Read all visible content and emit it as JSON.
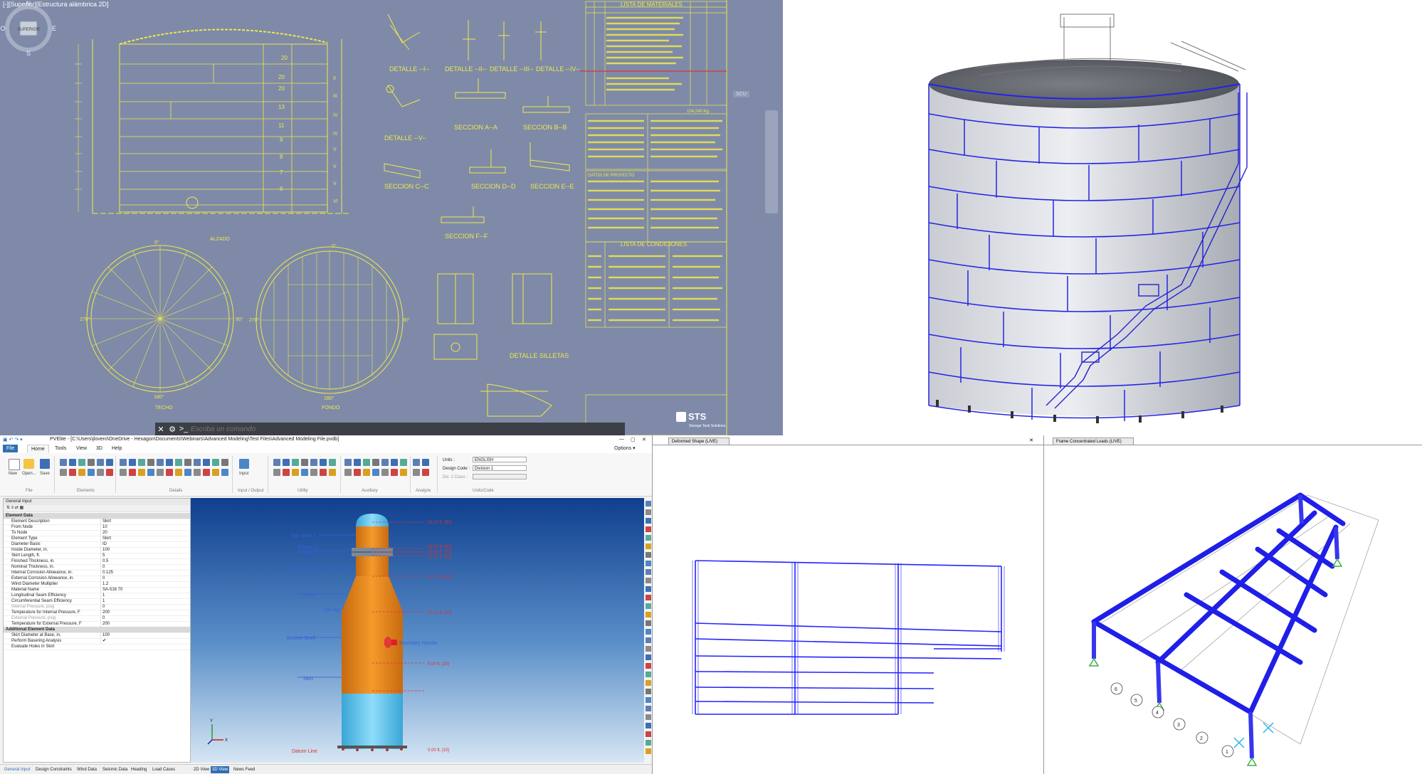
{
  "cad": {
    "viewport_label": "[-][Superior][Estructura alámbrica 2D]",
    "details": [
      "DETALLE --I--",
      "DETALLE --II--",
      "DETALLE --III--",
      "DETALLE --IV--",
      "DETALLE --V--"
    ],
    "sections": [
      "SECCION A--A",
      "SECCION B--B",
      "SECCION C--C",
      "SECCION D--D",
      "SECCION E--E",
      "SECCION F--F"
    ],
    "table_materials": "LISTA DE MATERIALES",
    "table_conditions": "LISTA DE CONDICIONES",
    "table_project": "DATOS DE PROYECTO",
    "total_weight": "104.240 Kg.",
    "label_alzado": "ALZADO",
    "label_techo": "TECHO",
    "label_fondo": "FONDO",
    "label_silletas": "DETALLE SILLETAS",
    "ring_numbers": [
      "20",
      "20",
      "20",
      "13",
      "11",
      "9",
      "8",
      "7",
      "6"
    ],
    "ring_romans": [
      "II",
      "III",
      "IV",
      "IV",
      "V",
      "V",
      "V",
      "VI"
    ],
    "angles": [
      "0°",
      "90°",
      "270°",
      "180°"
    ],
    "command_placeholder": "Escriba un comando",
    "compass": {
      "n": "N",
      "e": "E",
      "s": "S",
      "w": "O",
      "cube": "SUPERIOR",
      "ucs": "SCU"
    },
    "brand": "STS",
    "brand_sub": "Storage Tank Solutions"
  },
  "pvelite": {
    "window_title": "PVElite - [C:\\Users\\jlovero\\OneDrive - Hexagon\\Documents\\Webinars\\Advanced Modeling\\Test Files\\Advanced Modeling File.pvdb]",
    "options_label": "Options ▾",
    "menu": [
      "File",
      "Home",
      "Tools",
      "View",
      "3D",
      "Help"
    ],
    "ribbon": {
      "new": "New",
      "open": "Open...",
      "save": "Save",
      "input": "Input",
      "groups": [
        "File",
        "Elements",
        "Details",
        "Input / Output",
        "Utility",
        "Auxiliary",
        "Analyze",
        "Units/Code"
      ],
      "units_label": "Units :",
      "units_value": "ENGLISH",
      "code_label": "Design Code :",
      "code_value": "Division 1",
      "class_label": "Div. 2 Class :"
    },
    "panel_title": "General Input",
    "properties": [
      {
        "name": "Element Data",
        "value": "",
        "type": "section"
      },
      {
        "name": "Element Description",
        "value": "Skirt"
      },
      {
        "name": "From Node",
        "value": "10"
      },
      {
        "name": "To Node",
        "value": "20"
      },
      {
        "name": "Element Type",
        "value": "Skirt"
      },
      {
        "name": "Diameter Basis",
        "value": "ID"
      },
      {
        "name": "Inside Diameter, in.",
        "value": "100"
      },
      {
        "name": "Skirt Length, ft.",
        "value": "5"
      },
      {
        "name": "Finished Thickness, in.",
        "value": "0.5"
      },
      {
        "name": "Nominal Thickness, in.",
        "value": "0"
      },
      {
        "name": "Internal Corrosion Allowance, in.",
        "value": "0.125"
      },
      {
        "name": "External Corrosion Allowance, in.",
        "value": "0"
      },
      {
        "name": "Wind Diameter Multiplier",
        "value": "1.2"
      },
      {
        "name": "Material Name",
        "value": "SA-516 70"
      },
      {
        "name": "Longitudinal Seam Efficiency",
        "value": "1"
      },
      {
        "name": "Circumferential Seam Efficiency",
        "value": "1"
      },
      {
        "name": "Internal Pressure, psig",
        "value": "0",
        "type": "dim"
      },
      {
        "name": "Temperature for Internal Pressure, F",
        "value": "200"
      },
      {
        "name": "External Pressure, psig",
        "value": "0",
        "type": "dim"
      },
      {
        "name": "Temperature for External Pressure, F",
        "value": "200"
      },
      {
        "name": "Additional Element Data",
        "value": "",
        "type": "section"
      },
      {
        "name": "Skirt Diameter at Base, in.",
        "value": "100"
      },
      {
        "name": "Perform Basering Analysis",
        "value": "✔"
      },
      {
        "name": "Evaluate Holes in Skirt",
        "value": ""
      }
    ],
    "vessel_labels": {
      "top_shell_2": "Top Shell 2",
      "flange_2": "Flange 2",
      "flange_1": "Flange 1",
      "top_shell_1": "Top Shell 1",
      "cone": "Cone",
      "angle": "188 deg",
      "bottom_shell": "Bottom Shell",
      "nozzle": "Boundary Nozzle",
      "skirt": "Skirt",
      "datum": "Datum Line"
    },
    "elevations": [
      "33.17 ft. [90]",
      "26.67 ft. [80]",
      "25.92 ft. [70]",
      "25.17 ft. [60]",
      "21.17 ft. [50]",
      "15.17 ft. [40]",
      "5.00 ft. [20]",
      "0.00 ft. [10]"
    ],
    "axis": {
      "y": "Y",
      "x": "X"
    },
    "bottom_tabs": [
      "General Input",
      "Design Constraints",
      "Wind Data",
      "Seismic Data",
      "Heading",
      "Load Cases"
    ],
    "view_tabs": [
      "2D View",
      "3D View",
      "News Feed"
    ]
  },
  "structure": {
    "deformed_tab": "Deformed Shape (LIVE)",
    "loads_tab": "Frame Concentrated Loads (LIVE)",
    "close_glyph": "✕",
    "grid_labels": [
      "1",
      "2",
      "3",
      "4",
      "5",
      "6"
    ]
  },
  "colors": {
    "cad_bg": "#7e8aa8",
    "cad_line": "#f0e84a",
    "frame_blue": "#2323ff",
    "vessel_orange": "#f08a1c",
    "vessel_cyan": "#56c3ec",
    "view_bg_top": "#0f3f8f",
    "view_bg_bottom": "#cfe1f2",
    "red_label": "#e03030",
    "blue_label": "#3a5fd6",
    "accent": "#2f6fb3"
  }
}
